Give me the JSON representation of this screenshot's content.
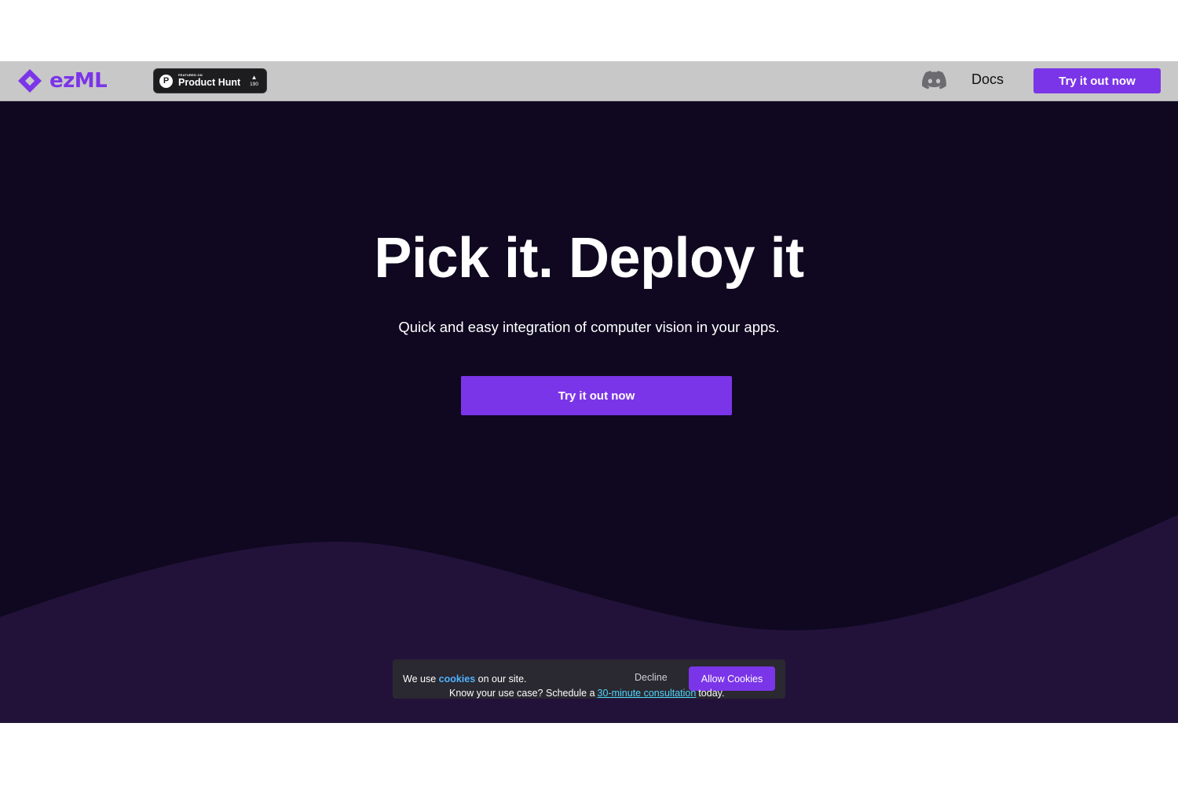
{
  "header": {
    "brand": "ezML",
    "product_hunt": {
      "kicker": "FEATURED ON",
      "name": "Product Hunt",
      "letter": "P",
      "votes": "190"
    },
    "discord_icon": "discord-icon",
    "docs_label": "Docs",
    "cta_label": "Try it out now"
  },
  "hero": {
    "title": "Pick it. Deploy it",
    "subtitle": "Quick and easy integration of computer vision in your apps.",
    "cta_label": "Try it out now"
  },
  "cookie_banner": {
    "prefix": "We use ",
    "link": "cookies",
    "suffix": " on our site.",
    "decline_label": "Decline",
    "allow_label": "Allow Cookies"
  },
  "consultation": {
    "prefix": "Know your use case? Schedule a",
    "link": "30-minute consultation",
    "suffix": "today."
  },
  "colors": {
    "accent": "#7b35e8",
    "hero_bg": "#0f0820",
    "wave": "#22123a",
    "header_bg": "#c8c8c8",
    "link": "#4fb3ff"
  }
}
